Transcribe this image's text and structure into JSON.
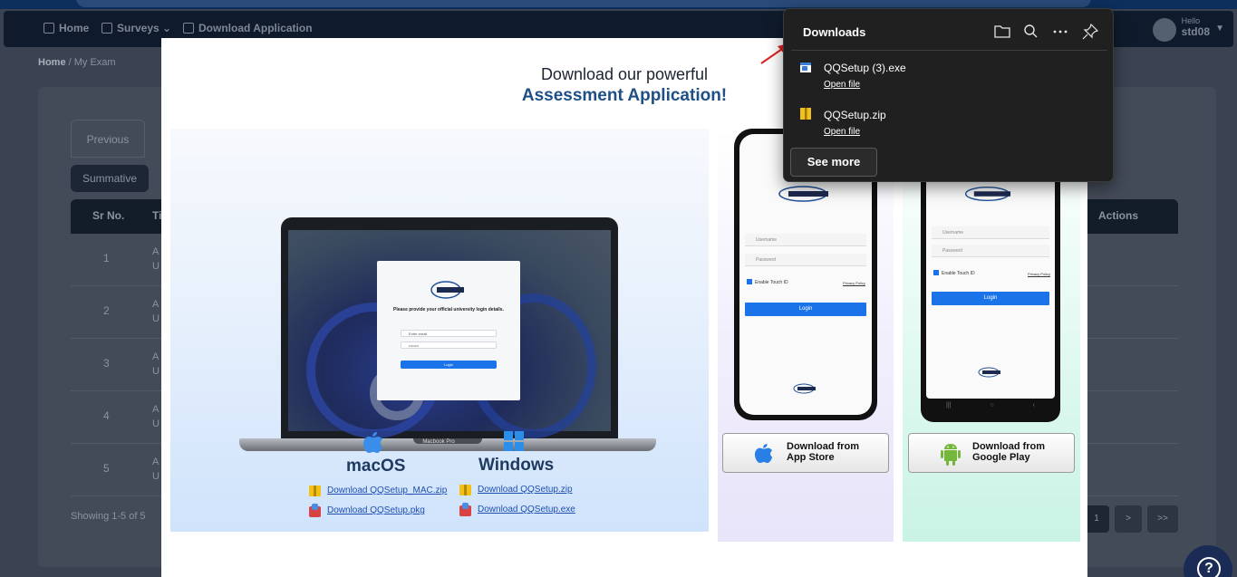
{
  "nav": {
    "home": "Home",
    "surveys": "Surveys",
    "download_app": "Download Application",
    "user_hello": "Hello",
    "user_name": "std08"
  },
  "breadcrumb": {
    "home": "Home",
    "sep": "/",
    "current": "My Exam"
  },
  "tabs": {
    "previous": "Previous"
  },
  "filter": {
    "summative": "Summative"
  },
  "table": {
    "headers": {
      "sr": "Sr No.",
      "title_partial": "Ti",
      "actions": "Actions"
    },
    "rows": [
      {
        "sr": "1",
        "line1": "A",
        "line2": "U"
      },
      {
        "sr": "2",
        "line1": "A",
        "line2": "U"
      },
      {
        "sr": "3",
        "line1": "A",
        "line2": "U"
      },
      {
        "sr": "4",
        "line1": "A",
        "line2": "U"
      },
      {
        "sr": "5",
        "line1": "A",
        "line2": "U"
      }
    ],
    "showing": "Showing 1-5 of 5",
    "pagination": {
      "current": "1",
      "next": ">",
      "last": ">>"
    }
  },
  "help": {
    "icon_label": "?"
  },
  "modal": {
    "title": "Download our powerful",
    "subtitle": "Assessment Application!",
    "laptop": {
      "label": "Macbook Pro",
      "prompt": "Please provide your official university login details.",
      "user_value": "Enter email",
      "pass_value": "••••••••",
      "login_label": "Login"
    },
    "macos": {
      "name": "macOS",
      "zip_link": "Download QQSetup_MAC.zip",
      "pkg_link": "Download QQSetup.pkg"
    },
    "windows": {
      "name": "Windows",
      "zip_link": "Download QQSetup.zip",
      "exe_link": "Download QQSetup.exe"
    },
    "phone": {
      "username": "Username",
      "password": "Password",
      "touch_id": "Enable Touch ID",
      "privacy": "Privacy Policy",
      "login": "Login"
    },
    "app_store": {
      "line1": "Download from",
      "line2": "App Store"
    },
    "google_play": {
      "line1": "Download from",
      "line2": "Google Play"
    }
  },
  "downloads_popup": {
    "title": "Downloads",
    "items": [
      {
        "name": "QQSetup (3).exe",
        "action": "Open file"
      },
      {
        "name": "QQSetup.zip",
        "action": "Open file"
      }
    ],
    "see_more": "See more"
  },
  "colors": {
    "accent_blue": "#1a73e8",
    "modal_subtitle": "#1e4f86",
    "popup_bg": "#202020",
    "arrow_red": "#e02020"
  }
}
